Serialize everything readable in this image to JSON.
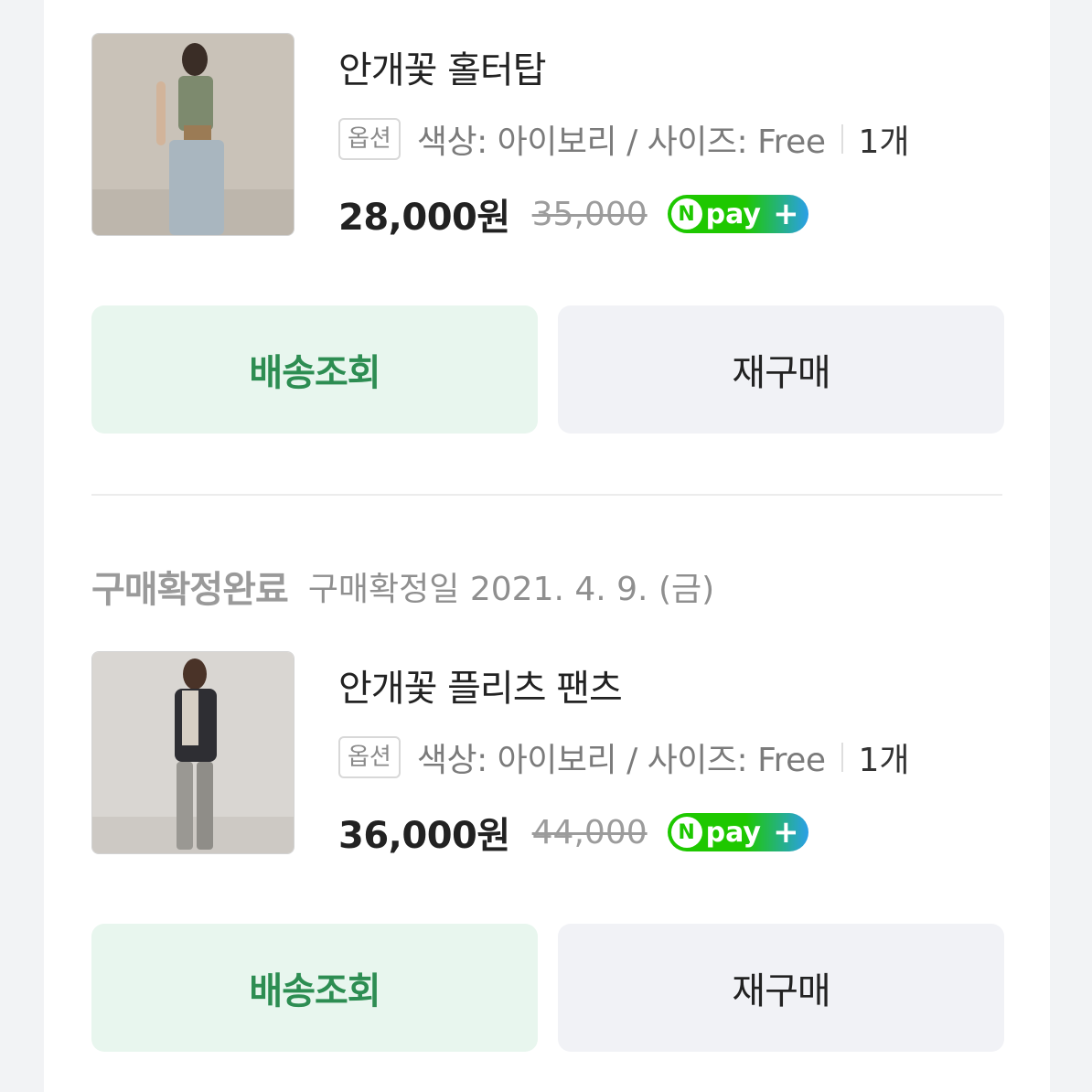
{
  "orders": [
    {
      "product_name": "안개꽃 홀터탑",
      "option_badge": "옵션",
      "option_text": "색상: 아이보리 / 사이즈: Free",
      "quantity": "1개",
      "price": "28,000원",
      "original_price": "35,000",
      "npay_label": "pay",
      "npay_n": "N",
      "npay_plus": "+",
      "track_button": "배송조회",
      "rebuy_button": "재구매"
    },
    {
      "status": "구매확정완료",
      "status_date": "구매확정일 2021. 4. 9. (금)",
      "product_name": "안개꽃 플리츠 팬츠",
      "option_badge": "옵션",
      "option_text": "색상: 아이보리 / 사이즈: Free",
      "quantity": "1개",
      "price": "36,000원",
      "original_price": "44,000",
      "npay_label": "pay",
      "npay_n": "N",
      "npay_plus": "+",
      "track_button": "배송조회",
      "rebuy_button": "재구매"
    }
  ],
  "colors": {
    "track_bg": "#e8f6ee",
    "track_text": "#2d8d52",
    "rebuy_bg": "#f1f2f6",
    "npay_green": "#1ec800",
    "npay_blue": "#2b9fe8"
  }
}
